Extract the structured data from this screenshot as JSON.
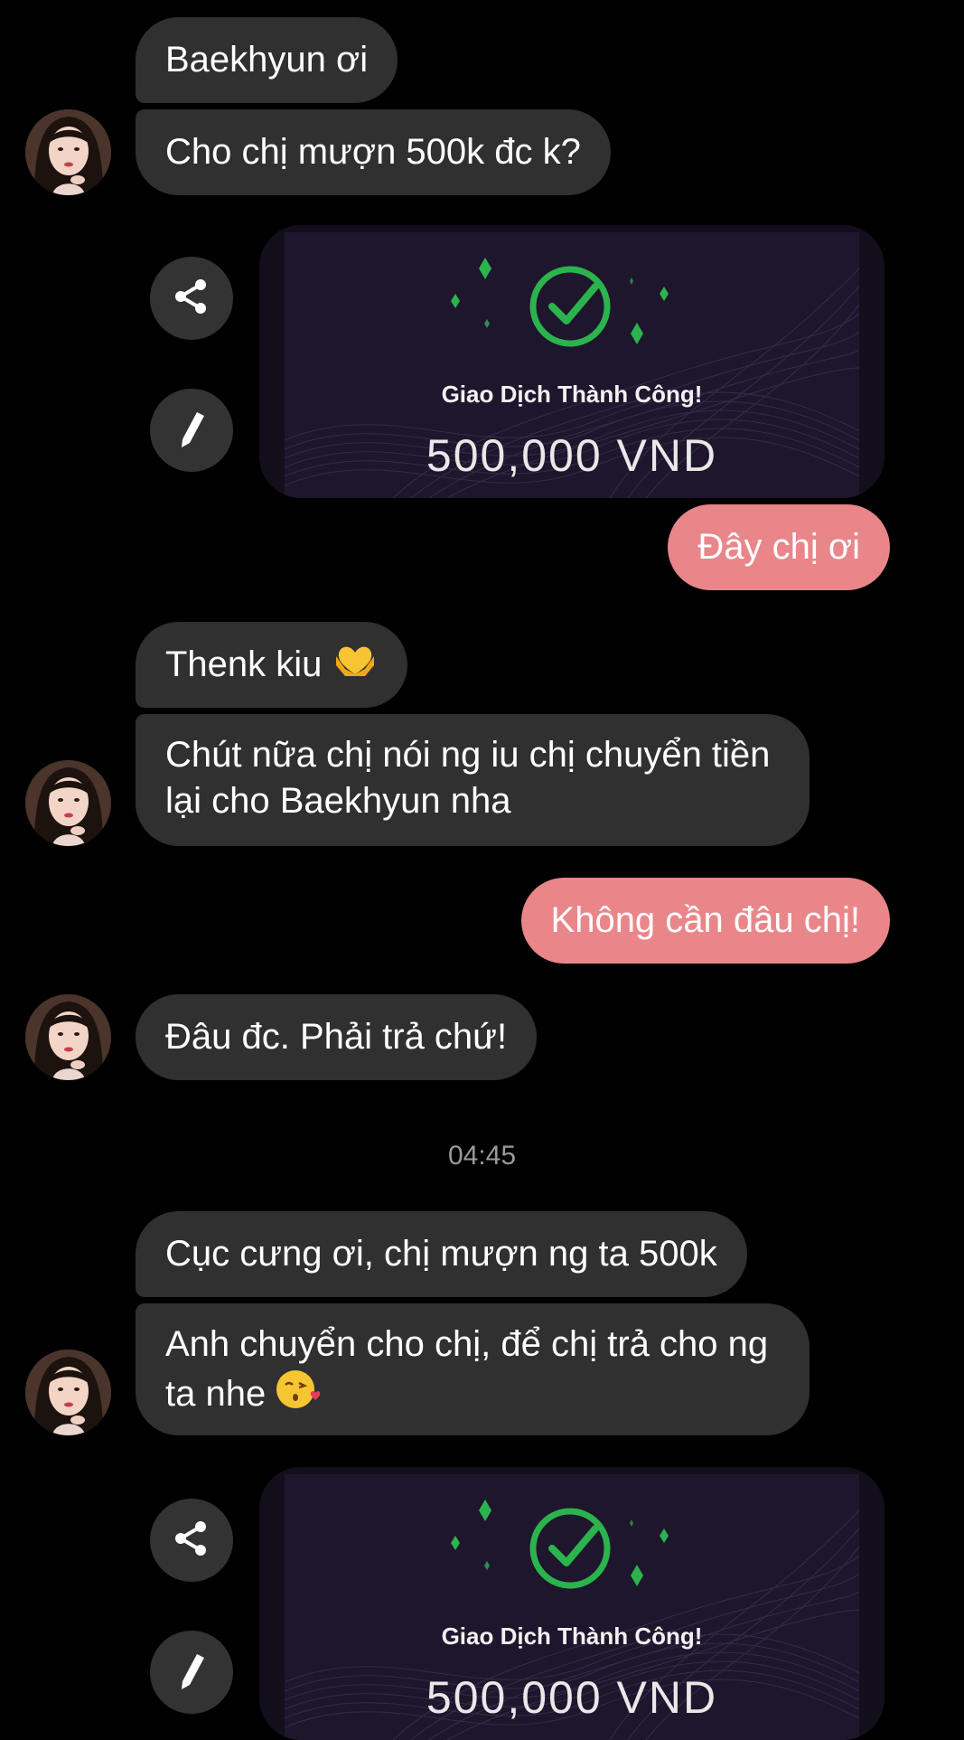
{
  "messages": {
    "m1": "Baekhyun ơi",
    "m2": "Cho chị mượn 500k đc k?",
    "m3": "Đây chị ơi",
    "m4": "Thenk kiu",
    "m5": "Chút nữa chị nói ng iu chị chuyển tiền lại cho Baekhyun nha",
    "m6": "Không cần đâu chị!",
    "m7": "Đâu đc. Phải trả chứ!",
    "m8": "Cục cưng ơi, chị mượn ng ta 500k",
    "m9": "Anh chuyển cho chị, để chị trả cho ng ta nhe"
  },
  "transfer_cards": [
    {
      "title": "Giao Dịch Thành Công!",
      "amount": "500,000 VND"
    },
    {
      "title": "Giao Dịch Thành Công!",
      "amount": "500,000 VND"
    }
  ],
  "timestamp": "04:45",
  "icons": {
    "share": "share-icon",
    "edit": "pencil-icon",
    "success": "check-circle-icon",
    "heart_hands": "heart-hands-emoji",
    "kiss_face": "kissing-heart-emoji"
  },
  "colors": {
    "background": "#000000",
    "incoming_bubble": "#303030",
    "outgoing_bubble": "#e8868a",
    "success_green": "#2bb34e",
    "card_background": "#1e162c"
  }
}
